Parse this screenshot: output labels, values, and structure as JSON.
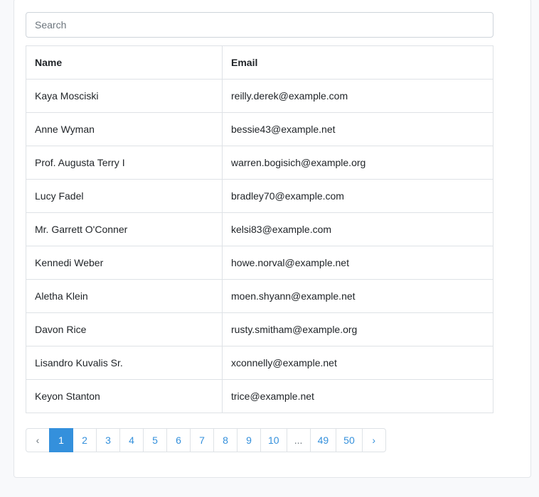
{
  "search": {
    "placeholder": "Search",
    "value": ""
  },
  "table": {
    "columns": [
      "Name",
      "Email"
    ],
    "rows": [
      {
        "name": "Kaya Mosciski",
        "email": "reilly.derek@example.com"
      },
      {
        "name": "Anne Wyman",
        "email": "bessie43@example.net"
      },
      {
        "name": "Prof. Augusta Terry I",
        "email": "warren.bogisich@example.org"
      },
      {
        "name": "Lucy Fadel",
        "email": "bradley70@example.com"
      },
      {
        "name": "Mr. Garrett O'Conner",
        "email": "kelsi83@example.com"
      },
      {
        "name": "Kennedi Weber",
        "email": "howe.norval@example.net"
      },
      {
        "name": "Aletha Klein",
        "email": "moen.shyann@example.net"
      },
      {
        "name": "Davon Rice",
        "email": "rusty.smitham@example.org"
      },
      {
        "name": "Lisandro Kuvalis Sr.",
        "email": "xconnelly@example.net"
      },
      {
        "name": "Keyon Stanton",
        "email": "trice@example.net"
      }
    ]
  },
  "pagination": {
    "prev": "‹",
    "next": "›",
    "items": [
      "1",
      "2",
      "3",
      "4",
      "5",
      "6",
      "7",
      "8",
      "9",
      "10",
      "...",
      "49",
      "50"
    ],
    "active": "1"
  },
  "colors": {
    "accent": "#3490dc",
    "border": "#dee2e6",
    "background": "#f8f9fb"
  }
}
